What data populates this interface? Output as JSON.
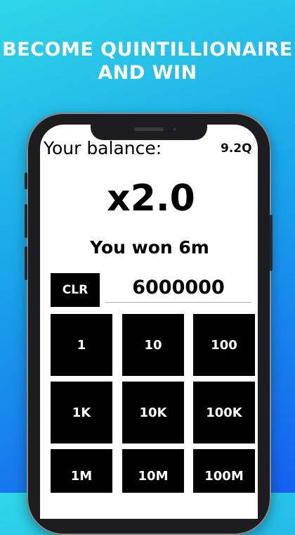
{
  "banner": {
    "line1": "BECOME QUINTILLIONAIRE",
    "line2": "AND WIN"
  },
  "header": {
    "balance_label": "Your balance:",
    "balance_value": "9.2Q"
  },
  "game": {
    "multiplier": "x2.0",
    "result_text": "You won 6m"
  },
  "bet": {
    "clear_label": "CLR",
    "amount": "6000000"
  },
  "keypad": {
    "keys": [
      "1",
      "10",
      "100",
      "1K",
      "10K",
      "100K",
      "1M",
      "10M",
      "100M"
    ]
  },
  "colors": {
    "background_top": "#2fd6e8",
    "background_bottom": "#1560f0",
    "key": "#000000",
    "screen": "#ffffff"
  }
}
